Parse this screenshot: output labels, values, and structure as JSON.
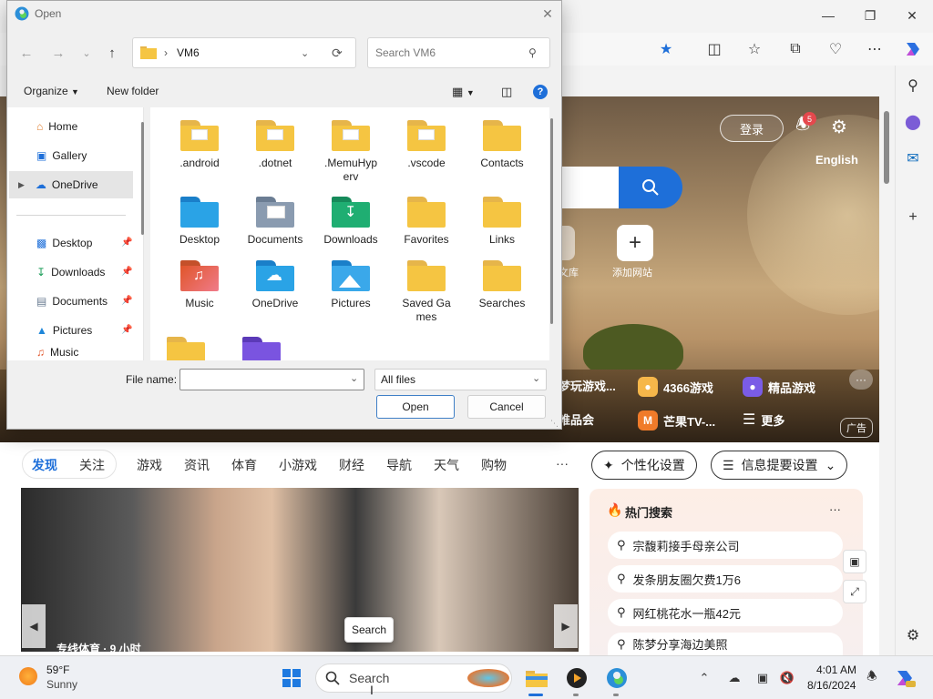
{
  "dialog": {
    "title": "Open",
    "path_segment": "VM6",
    "search_placeholder": "Search VM6",
    "organize_label": "Organize",
    "new_folder_label": "New folder",
    "nav_items": [
      {
        "label": "Home",
        "icon": "home-icon"
      },
      {
        "label": "Gallery",
        "icon": "gallery-icon"
      },
      {
        "label": "OneDrive",
        "icon": "cloud-icon",
        "selected": true
      },
      {
        "label": "Desktop",
        "icon": "desktop-icon"
      },
      {
        "label": "Downloads",
        "icon": "download-icon"
      },
      {
        "label": "Documents",
        "icon": "documents-icon"
      },
      {
        "label": "Pictures",
        "icon": "pictures-icon"
      },
      {
        "label": "Music",
        "icon": "music-icon"
      }
    ],
    "files": [
      {
        "label": ".android",
        "icon": "folder-icon"
      },
      {
        "label": ".dotnet",
        "icon": "folder-icon"
      },
      {
        "label": ".MemuHyperv",
        "icon": "folder-icon"
      },
      {
        "label": ".vscode",
        "icon": "folder-icon"
      },
      {
        "label": "Contacts",
        "icon": "folder-icon"
      },
      {
        "label": "Desktop",
        "icon": "desktop-folder-icon"
      },
      {
        "label": "Documents",
        "icon": "documents-folder-icon"
      },
      {
        "label": "Downloads",
        "icon": "downloads-folder-icon"
      },
      {
        "label": "Favorites",
        "icon": "folder-icon"
      },
      {
        "label": "Links",
        "icon": "folder-icon"
      },
      {
        "label": "Music",
        "icon": "music-folder-icon"
      },
      {
        "label": "OneDrive",
        "icon": "onedrive-folder-icon"
      },
      {
        "label": "Pictures",
        "icon": "pictures-folder-icon"
      },
      {
        "label": "Saved Games",
        "icon": "folder-icon"
      },
      {
        "label": "Searches",
        "icon": "folder-icon"
      }
    ],
    "file_name_label": "File name:",
    "file_name_value": "",
    "file_type": "All files",
    "open_button": "Open",
    "cancel_button": "Cancel"
  },
  "browser": {
    "hero": {
      "login": "登录",
      "notification_count": "5",
      "language": "English",
      "shortcut_partial_label": "文库",
      "add_site_label": "添加网站",
      "links_row1": [
        "梦玩游戏...",
        "4366游戏",
        "精品游戏"
      ],
      "links_row2": [
        "唯品会",
        "芒果TV-...",
        "更多"
      ],
      "ad_label": "广告"
    },
    "feed_tabs": [
      "发现",
      "关注",
      "游戏",
      "资讯",
      "体育",
      "小游戏",
      "财经",
      "导航",
      "天气",
      "购物"
    ],
    "feed_more": "···",
    "personalize_button": "个性化设置",
    "info_settings_button": "信息提要设置",
    "news_caption": "专线体育 · 9 小时",
    "tooltip": "Search",
    "hot_search": {
      "title": "热门搜索",
      "more": "···",
      "items": [
        "宗馥莉接手母亲公司",
        "发条朋友圈欠费1万6",
        "网红桃花水一瓶42元",
        "陈梦分享海边美照"
      ]
    }
  },
  "taskbar": {
    "weather_temp": "59°F",
    "weather_desc": "Sunny",
    "search_placeholder": "Search",
    "time": "4:01 AM",
    "date": "8/16/2024"
  },
  "colors": {
    "accent": "#1e6fd9",
    "folder": "#f5c542",
    "notification": "#e5484d"
  }
}
